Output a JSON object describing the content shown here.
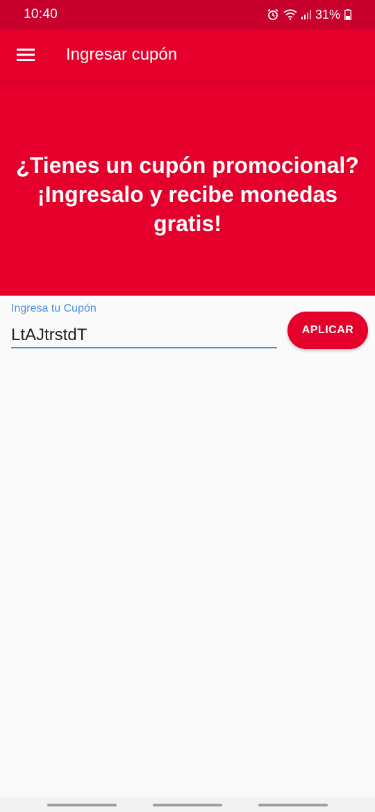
{
  "status_bar": {
    "time": "10:40",
    "battery": "31%",
    "icons": [
      "alarm-icon",
      "wifi-icon",
      "signal-icon",
      "battery-icon"
    ]
  },
  "app_bar": {
    "title": "Ingresar cupón",
    "menu_icon": "hamburger-menu-icon"
  },
  "banner": {
    "text": "¿Tienes un cupón promocional? ¡Ingresalo y recibe monedas gratis!"
  },
  "coupon": {
    "label": "Ingresa tu Cupón",
    "value": "LtAJtrstdT"
  },
  "apply_button": {
    "label": "APLICAR"
  },
  "colors": {
    "primary": "#e4002b",
    "status_bar": "#c8002c",
    "accent_blue": "#4a90e2",
    "background": "#fafafa"
  }
}
